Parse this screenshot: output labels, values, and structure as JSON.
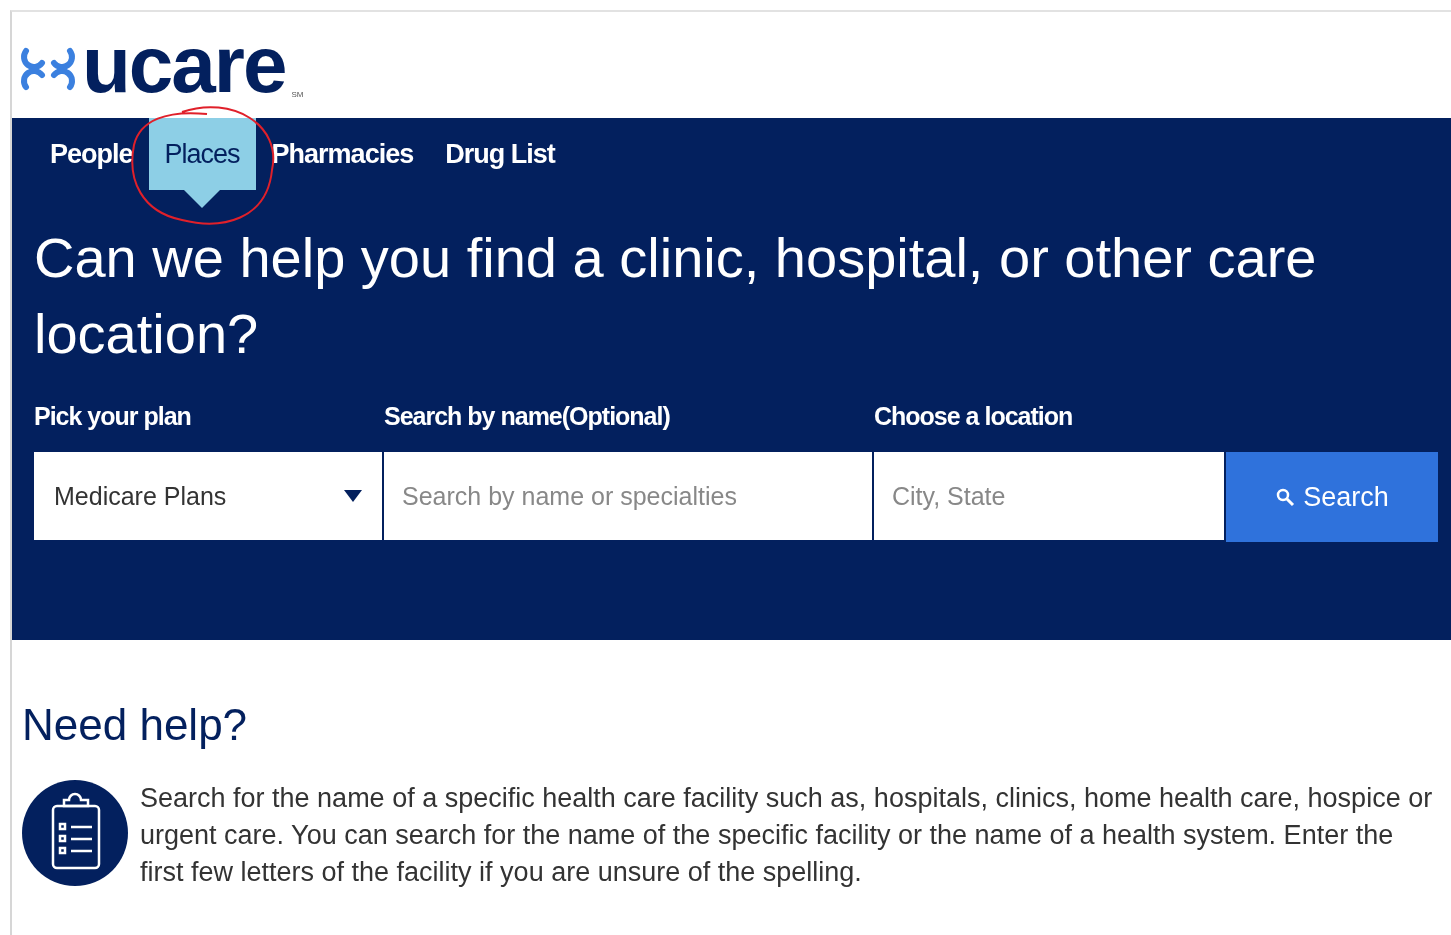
{
  "logo": {
    "wordmark": "ucare",
    "mark": "SM"
  },
  "tabs": [
    {
      "label": "People",
      "selected": false
    },
    {
      "label": "Places",
      "selected": true
    },
    {
      "label": "Pharmacies",
      "selected": false
    },
    {
      "label": "Drug List",
      "selected": false
    }
  ],
  "annotation": {
    "kind": "circle"
  },
  "heading": "Can we help you find a clinic, hospital, or other care location?",
  "search_form": {
    "plan": {
      "label": "Pick your plan",
      "value": "Medicare Plans"
    },
    "name": {
      "label": "Search by name(Optional)",
      "placeholder": "Search by name or specialties"
    },
    "location": {
      "label": "Choose a location",
      "placeholder": "City, State"
    },
    "button": "Search"
  },
  "help": {
    "title": "Need help?",
    "text": "Search for the name of a specific health care facility such as, hospitals, clinics, home health care, hospice or urgent care. You can search for the name of the specific facility or the name of a health system. Enter the first few letters of the facility if you are unsure of the spelling."
  }
}
